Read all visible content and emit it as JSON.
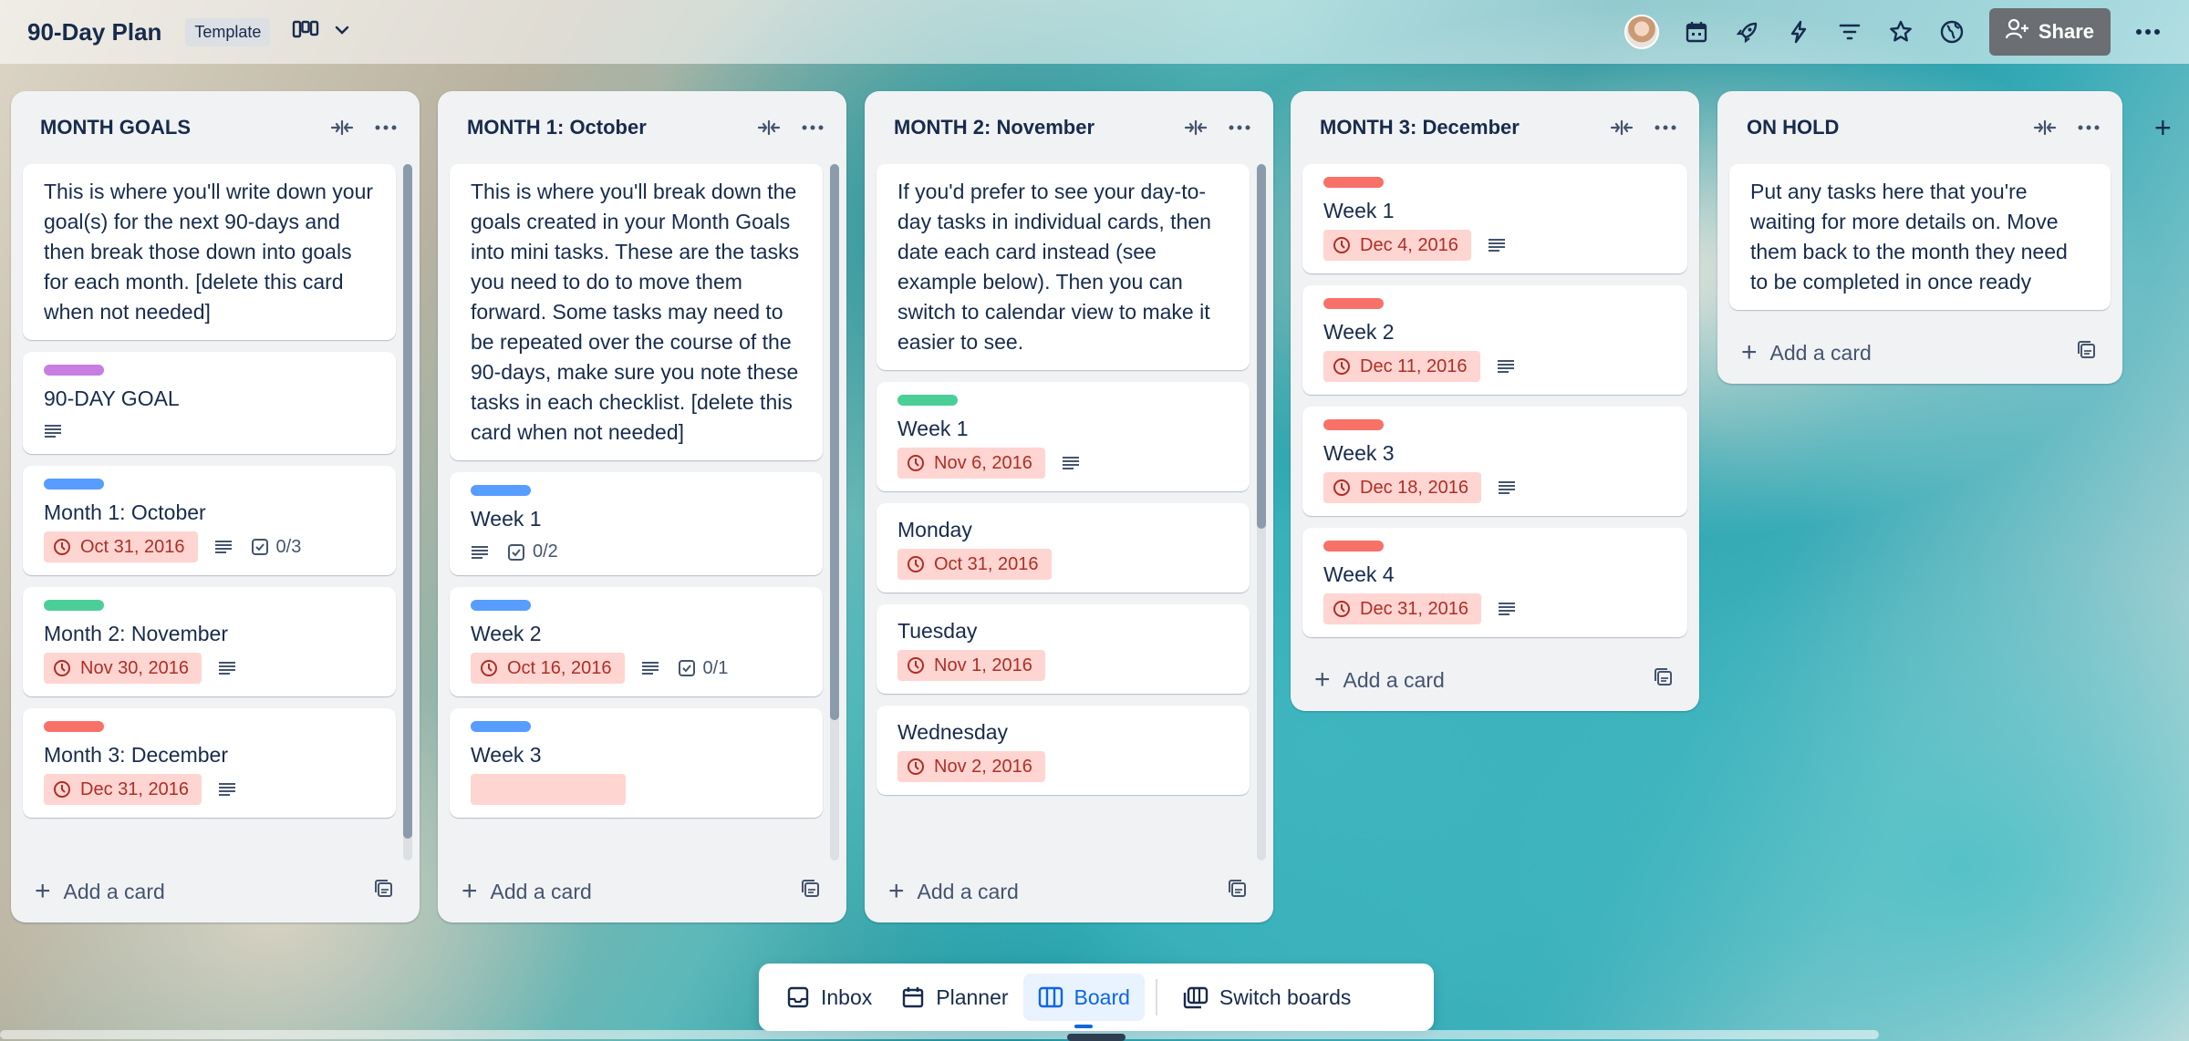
{
  "header": {
    "title": "90-Day Plan",
    "badge": "Template",
    "share_label": "Share",
    "icons": [
      "board-view-icon",
      "chevron-down-icon",
      "avatar",
      "calendar-icon",
      "rocket-icon",
      "lightning-icon",
      "filter-icon",
      "star-icon",
      "globe-icon",
      "add-person-icon",
      "more-icon"
    ]
  },
  "colors": {
    "label_purple": "#c77ee0",
    "label_blue": "#579dff",
    "label_green": "#4bce97",
    "label_red": "#f87168",
    "due_bg": "#ffd5d2",
    "due_text": "#ae2e24",
    "board_accent": "#0c66e4"
  },
  "lists": [
    {
      "title": "MONTH GOALS",
      "add_label": "Add a card",
      "cards": [
        {
          "text": "This is where you'll write down your goal(s) for the next 90-days and then break those down into goals for each month. [delete this card when not needed]"
        },
        {
          "label": "purple",
          "title": "90-DAY GOAL",
          "desc": true
        },
        {
          "label": "blue",
          "title": "Month 1: October",
          "due": "Oct 31, 2016",
          "desc": true,
          "checklist": "0/3"
        },
        {
          "label": "green",
          "title": "Month 2: November",
          "due": "Nov 30, 2016",
          "desc": true
        },
        {
          "label": "red",
          "title": "Month 3: December",
          "due": "Dec 31, 2016",
          "desc": true
        }
      ]
    },
    {
      "title": "MONTH 1: October",
      "add_label": "Add a card",
      "cards": [
        {
          "text": "This is where you'll break down the goals created in your Month Goals into mini tasks. These are the tasks you need to do to move them forward. Some tasks may need to be repeated over the course of the 90-days, make sure you note these tasks in each checklist. [delete this card when not needed]"
        },
        {
          "label": "blue",
          "title": "Week 1",
          "desc": true,
          "checklist": "0/2"
        },
        {
          "label": "blue",
          "title": "Week 2",
          "due": "Oct 16, 2016",
          "desc": true,
          "checklist": "0/1"
        },
        {
          "label": "blue",
          "title": "Week 3"
        }
      ]
    },
    {
      "title": "MONTH 2: November",
      "add_label": "Add a card",
      "cards": [
        {
          "text": "If you'd prefer to see your day-to-day tasks in individual cards, then date each card instead (see example below). Then you can switch to calendar view to make it easier to see."
        },
        {
          "label": "green",
          "title": "Week 1",
          "due": "Nov 6, 2016",
          "desc": true
        },
        {
          "title": "Monday",
          "due": "Oct 31, 2016"
        },
        {
          "title": "Tuesday",
          "due": "Nov 1, 2016"
        },
        {
          "title": "Wednesday",
          "due": "Nov 2, 2016"
        }
      ]
    },
    {
      "title": "MONTH 3: December",
      "add_label": "Add a card",
      "cards": [
        {
          "label": "red",
          "title": "Week 1",
          "due": "Dec 4, 2016",
          "desc": true
        },
        {
          "label": "red",
          "title": "Week 2",
          "due": "Dec 11, 2016",
          "desc": true
        },
        {
          "label": "red",
          "title": "Week 3",
          "due": "Dec 18, 2016",
          "desc": true
        },
        {
          "label": "red",
          "title": "Week 4",
          "due": "Dec 31, 2016",
          "desc": true
        }
      ]
    },
    {
      "title": "ON HOLD",
      "add_label": "Add a card",
      "cards": [
        {
          "text": "Put any tasks here that you're waiting for more details on. Move them back to the month they need to be completed in once ready"
        }
      ]
    }
  ],
  "bottom_bar": {
    "inbox": "Inbox",
    "planner": "Planner",
    "board": "Board",
    "switch": "Switch boards"
  }
}
